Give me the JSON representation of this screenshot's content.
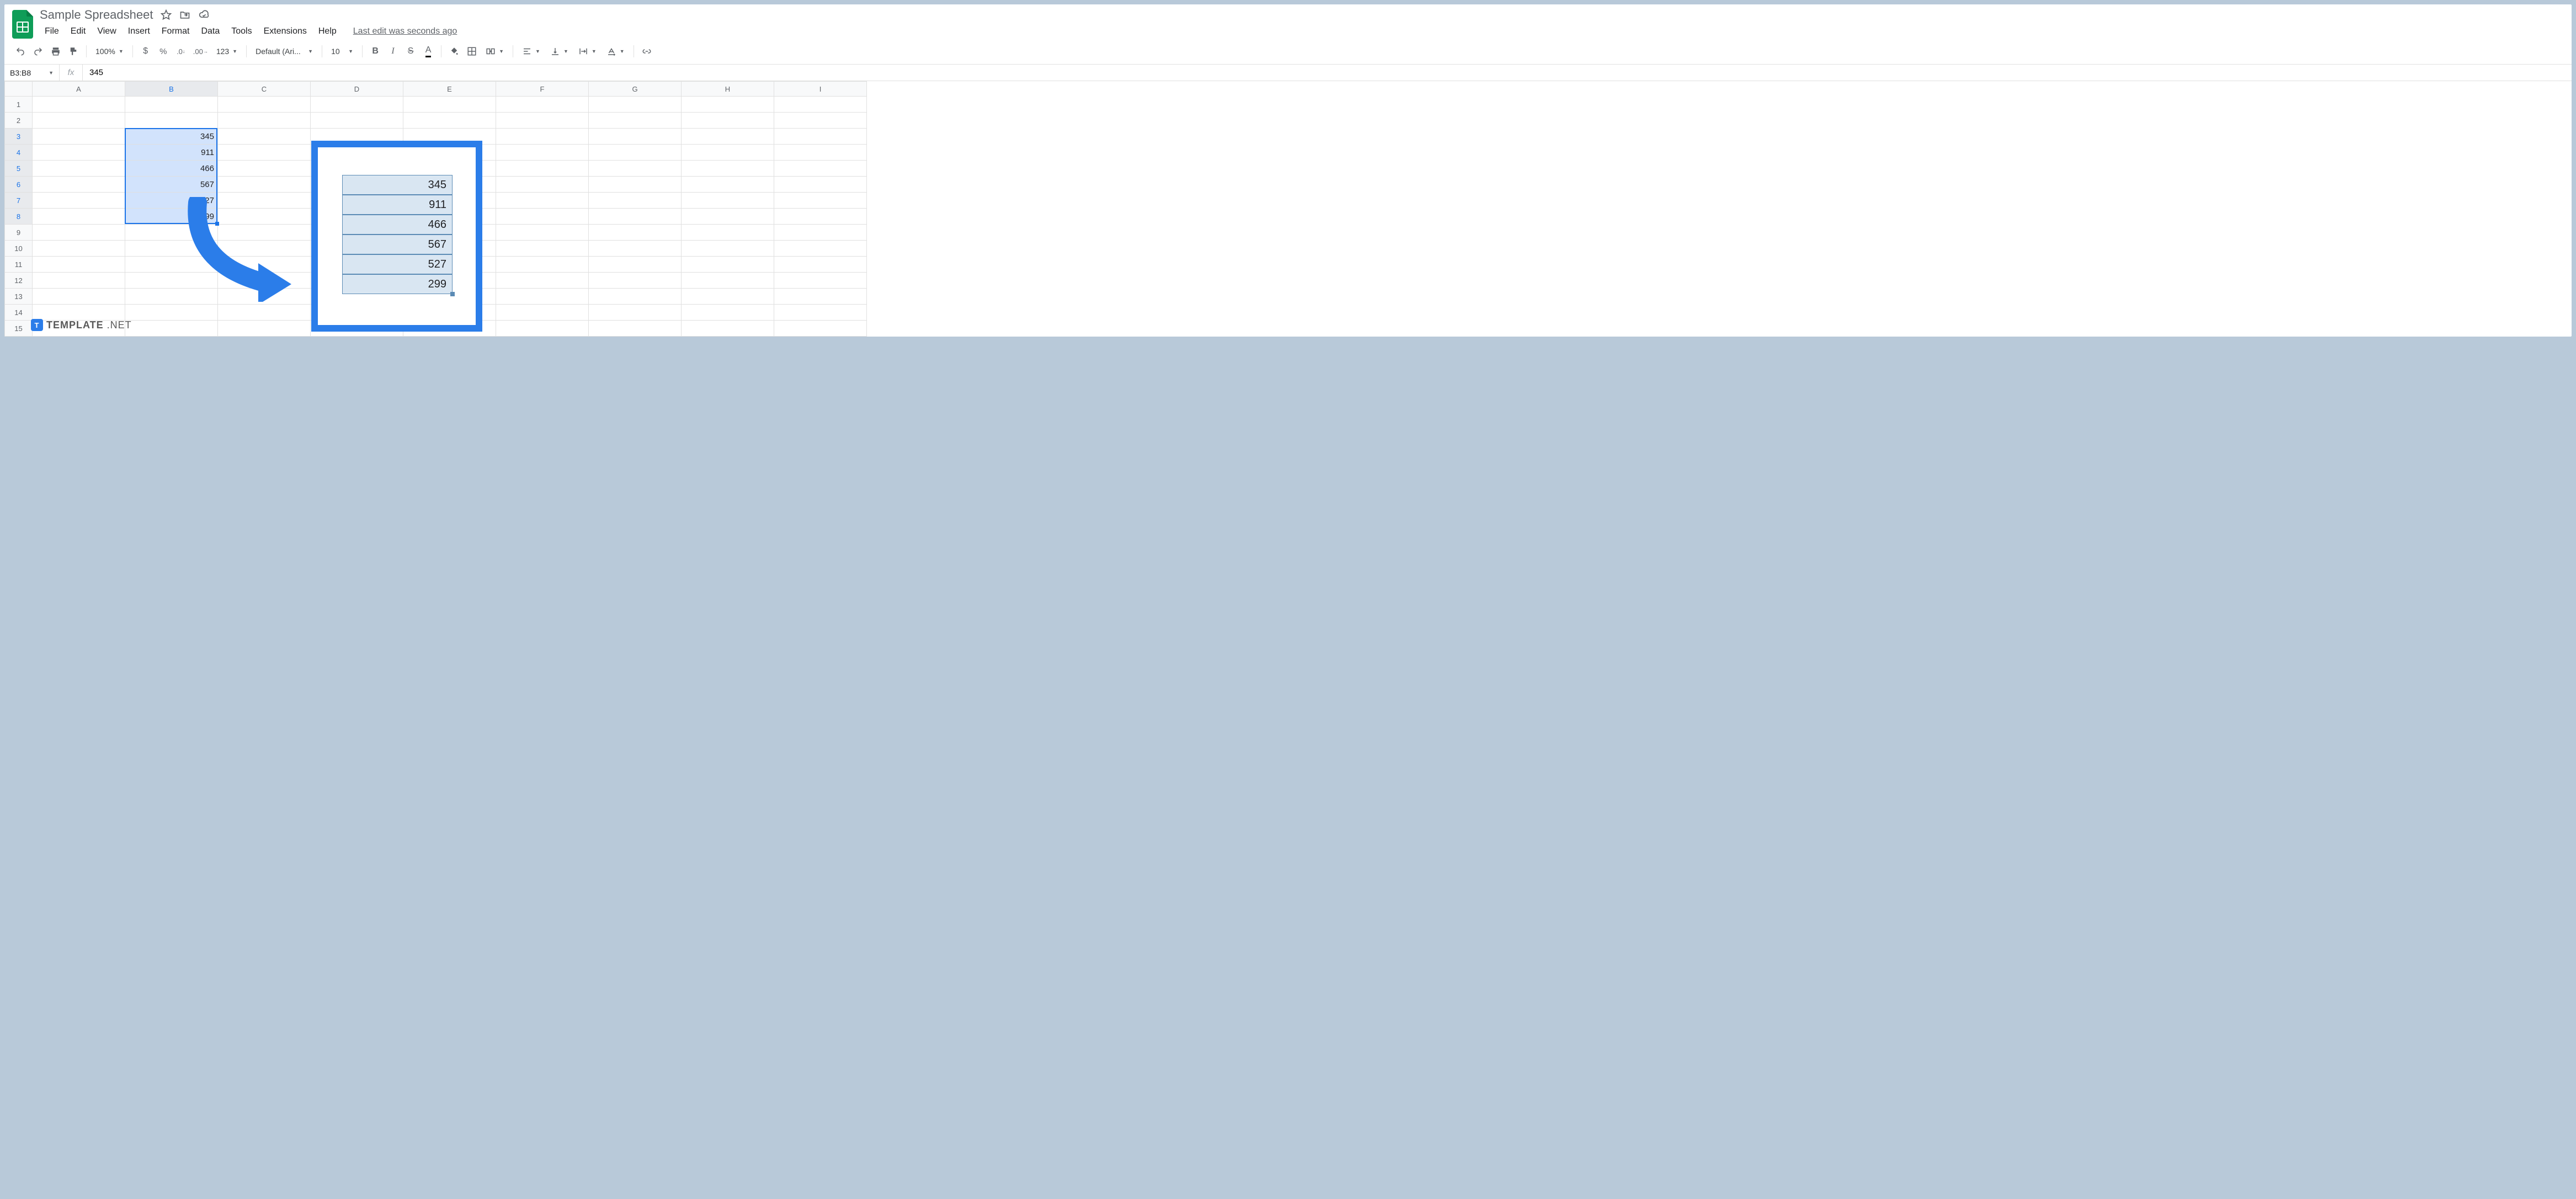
{
  "doc": {
    "title": "Sample Spreadsheet",
    "last_edit": "Last edit was seconds ago"
  },
  "menu": {
    "file": "File",
    "edit": "Edit",
    "view": "View",
    "insert": "Insert",
    "format": "Format",
    "data": "Data",
    "tools": "Tools",
    "extensions": "Extensions",
    "help": "Help"
  },
  "toolbar": {
    "zoom": "100%",
    "font": "Default (Ari...",
    "font_size": "10",
    "currency": "$",
    "percent": "%",
    "dec_dec": ".0",
    "dec_inc": ".00",
    "more_formats": "123"
  },
  "formula": {
    "range": "B3:B8",
    "fx": "fx",
    "value": "345"
  },
  "columns": [
    "A",
    "B",
    "C",
    "D",
    "E",
    "F",
    "G",
    "H",
    "I"
  ],
  "rows": [
    "1",
    "2",
    "3",
    "4",
    "5",
    "6",
    "7",
    "8",
    "9",
    "10",
    "11",
    "12",
    "13",
    "14",
    "15"
  ],
  "cells": {
    "B3": "345",
    "B4": "911",
    "B5": "466",
    "B6": "567",
    "B7": "527",
    "B8": "299"
  },
  "callout": {
    "values": [
      "345",
      "911",
      "466",
      "567",
      "527",
      "299"
    ]
  },
  "selection": {
    "col": "B",
    "rows_start": 3,
    "rows_end": 8
  },
  "watermark": {
    "brand": "TEMPLATE",
    "suffix": ".NET",
    "badge": "T"
  }
}
